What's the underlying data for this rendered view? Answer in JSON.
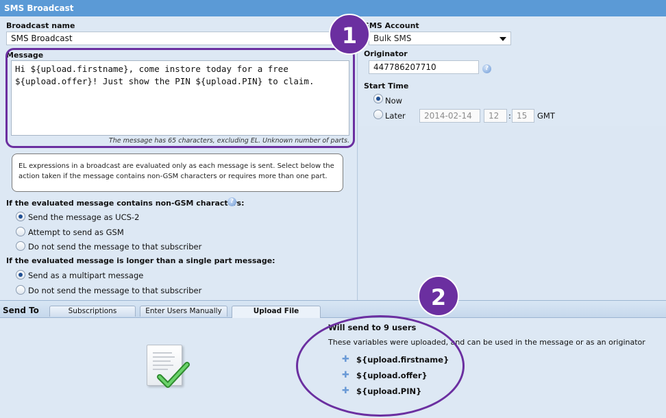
{
  "window": {
    "title": "SMS Broadcast"
  },
  "form": {
    "broadcast_name_label": "Broadcast name",
    "broadcast_name_value": "SMS Broadcast",
    "message_label": "Message",
    "message_value": "Hi ${upload.firstname}, come instore today for a free\n${upload.offer}! Just show the PIN ${upload.PIN} to claim.",
    "message_hint": "The message has 65 characters, excluding EL. Unknown number of parts.",
    "info_text": "EL expressions in a broadcast are evaluated only as each message is sent. Select below the action taken if the message contains non-GSM characters or requires more than one part.",
    "nongsm_label": "If the evaluated message contains non-GSM characters:",
    "nongsm_options": [
      "Send the message as UCS-2",
      "Attempt to send as GSM",
      "Do not send the message to that subscriber"
    ],
    "nongsm_selected": 0,
    "longer_label": "If the evaluated message is longer than a single part message:",
    "longer_options": [
      "Send as a multipart message",
      "Do not send the message to that subscriber"
    ],
    "longer_selected": 0
  },
  "account": {
    "sms_account_label": "SMS Account",
    "sms_account_value": "Bulk SMS",
    "originator_label": "Originator",
    "originator_value": "447786207710",
    "start_time_label": "Start Time",
    "now_label": "Now",
    "later_label": "Later",
    "start_time_selected": "now",
    "later_date": "2014-02-14",
    "later_hour": "12",
    "later_sep": ":",
    "later_minute": "15",
    "timezone": "GMT"
  },
  "send_to": {
    "title": "Send To",
    "tabs": [
      "Subscriptions",
      "Enter Users Manually",
      "Upload File"
    ],
    "active_tab": 2,
    "will_send": "Will send to 9 users",
    "variables_text": "These variables were uploaded, and can be used in the message or as an originator",
    "variables": [
      "${upload.firstname}",
      "${upload.offer}",
      "${upload.PIN}"
    ]
  },
  "annotations": {
    "badge_1": "1",
    "badge_2": "2"
  },
  "colors": {
    "accent": "#6b2fa0",
    "titlebar": "#5b9ad6",
    "pane": "#dde8f4"
  },
  "icons": {
    "help": "question-circle-icon",
    "add": "plus-icon",
    "upload_ok": "document-check-icon"
  }
}
